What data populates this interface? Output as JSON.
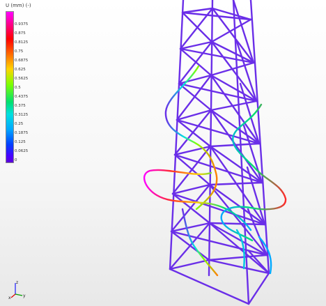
{
  "legend": {
    "title": "U (mm) (-)",
    "ticks": [
      "0.9375",
      "0.875",
      "0.8125",
      "0.75",
      "0.6875",
      "0.625",
      "0.5625",
      "0.5",
      "0.4375",
      "0.375",
      "0.3125",
      "0.25",
      "0.1875",
      "0.125",
      "0.0625",
      "0"
    ],
    "max_value": 1.0,
    "colors": [
      "#ff00ff",
      "#ff0000",
      "#ff7f00",
      "#ffd400",
      "#7fff00",
      "#00e070",
      "#00e0e0",
      "#00a8ff",
      "#0040ff",
      "#5a00d8"
    ]
  },
  "triad": {
    "x_label": "x",
    "y_label": "y",
    "z_label": "z"
  },
  "model": {
    "frame_color": "#6a2ee8",
    "description": "lattice tower mesh with deformed mode shape"
  }
}
